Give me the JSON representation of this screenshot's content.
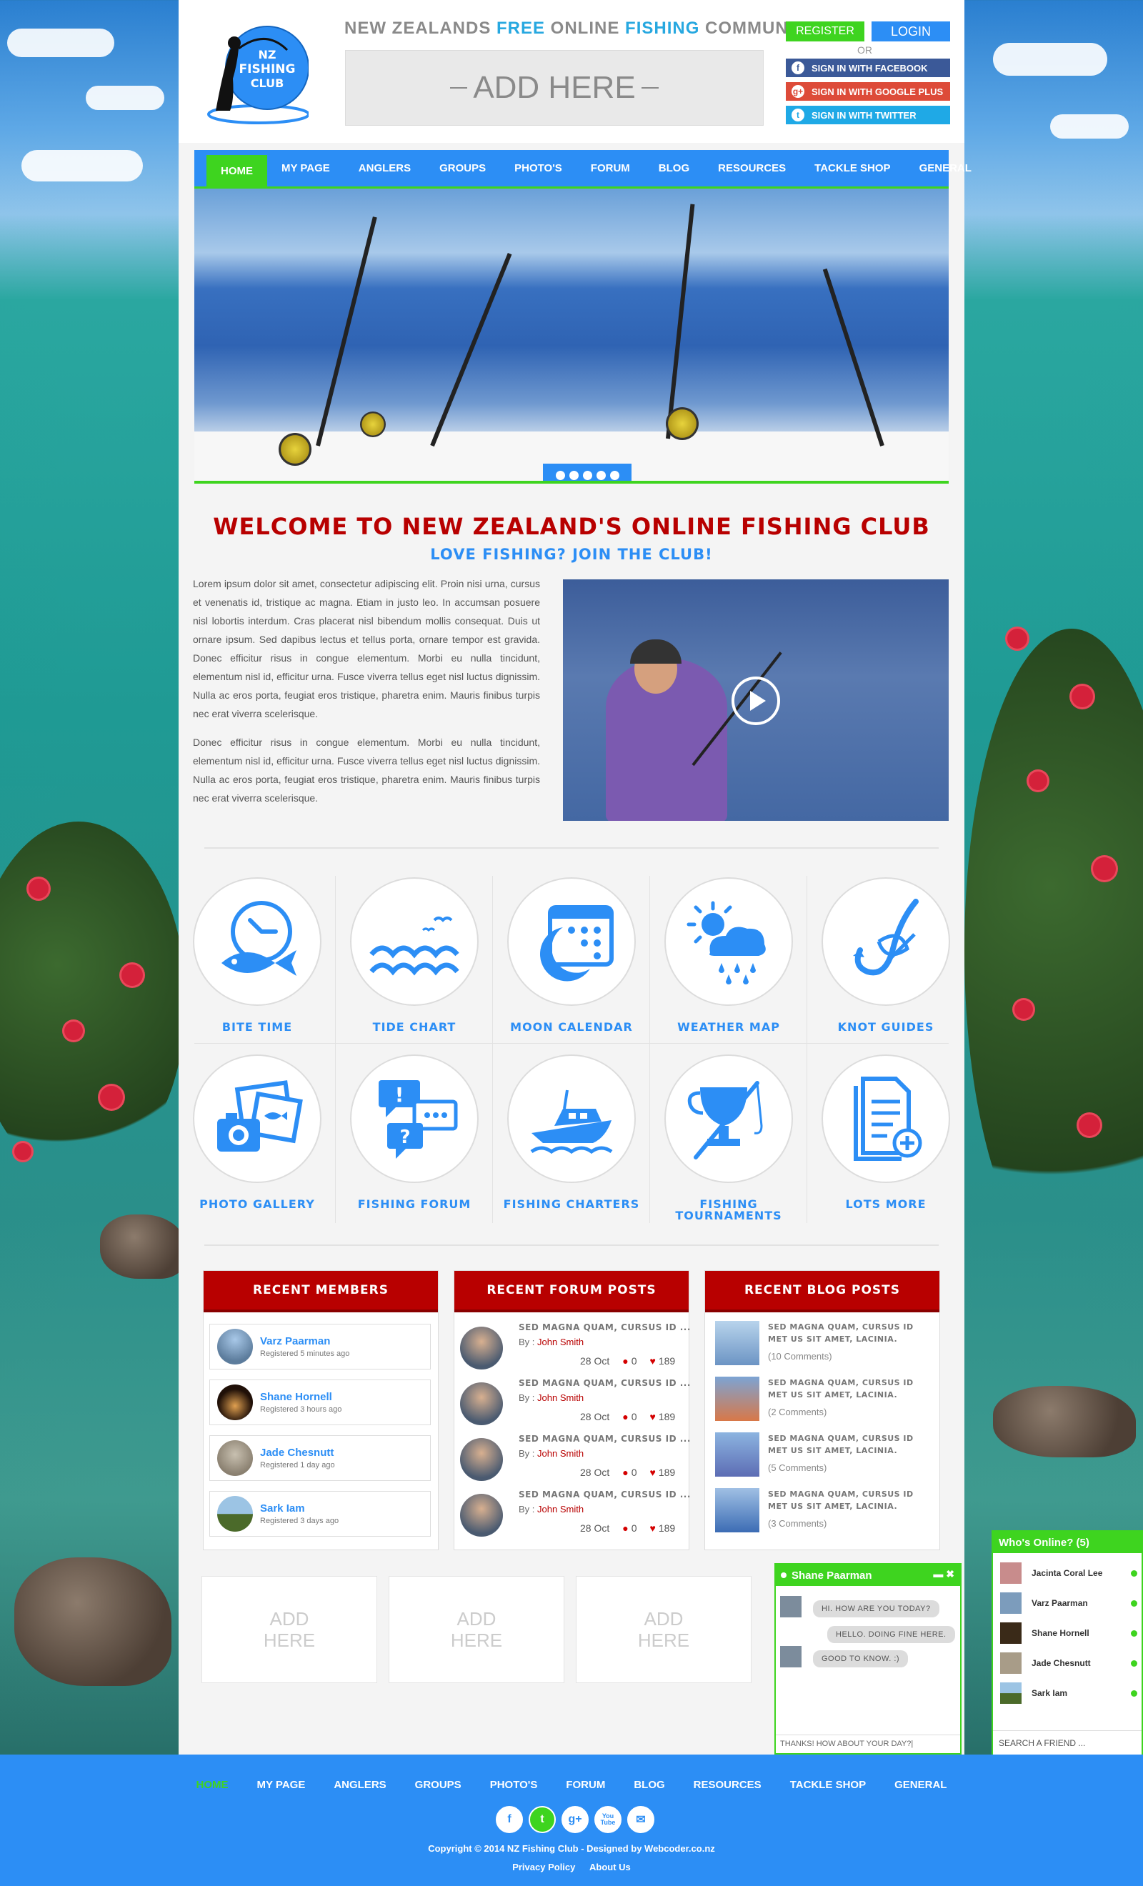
{
  "header": {
    "tagline_parts": [
      "NEW ZEALANDS ",
      "FREE",
      " ONLINE ",
      "FISHING",
      " COMMUNITY"
    ],
    "ad_text": "ADD HERE",
    "logo_text": [
      "NZ",
      "FISHING",
      "CLUB"
    ],
    "register_label": "REGISTER",
    "login_label": "LOGIN",
    "or_label": "OR",
    "facebook_label": "SIGN IN WITH FACEBOOK",
    "google_label": "SIGN IN WITH GOOGLE PLUS",
    "twitter_label": "SIGN IN WITH TWITTER"
  },
  "nav": [
    "HOME",
    "MY PAGE",
    "ANGLERS",
    "GROUPS",
    "PHOTO'S",
    "FORUM",
    "BLOG",
    "RESOURCES",
    "TACKLE SHOP",
    "GENERAL"
  ],
  "slider": {
    "dot_count": 5
  },
  "welcome": {
    "title": "WELCOME TO NEW ZEALAND'S ONLINE FISHING CLUB",
    "subtitle": "LOVE FISHING? JOIN THE CLUB!",
    "p1": " Lorem ipsum dolor sit amet, consectetur adipiscing elit. Proin nisi urna, cursus et venenatis id, tristique ac magna. Etiam in justo leo. In accumsan posuere nisl lobortis interdum. Cras placerat nisl bibendum mollis consequat. Duis ut ornare ipsum. Sed dapibus lectus et tellus porta, ornare tempor est gravida. Donec efficitur risus in congue elementum. Morbi eu nulla tincidunt, elementum nisl id, efficitur urna. Fusce viverra tellus eget nisl luctus dignissim. Nulla ac eros porta, feugiat eros tristique, pharetra enim. Mauris finibus turpis nec erat viverra scelerisque.",
    "p2": "Donec efficitur risus in congue elementum. Morbi eu nulla tincidunt, elementum nisl id, efficitur urna. Fusce viverra tellus eget nisl luctus dignissim. Nulla ac eros porta, feugiat eros tristique, pharetra enim. Mauris finibus turpis nec erat viverra scelerisque."
  },
  "features": [
    {
      "label": "BITE TIME",
      "icon": "clock-fish-icon"
    },
    {
      "label": "TIDE CHART",
      "icon": "waves-icon"
    },
    {
      "label": "MOON CALENDAR",
      "icon": "moon-calendar-icon"
    },
    {
      "label": "WEATHER MAP",
      "icon": "weather-icon"
    },
    {
      "label": "KNOT GUIDES",
      "icon": "hook-knot-icon"
    },
    {
      "label": "PHOTO GALLERY",
      "icon": "photos-icon"
    },
    {
      "label": "FISHING FORUM",
      "icon": "chat-bubbles-icon"
    },
    {
      "label": "FISHING CHARTERS",
      "icon": "boat-icon"
    },
    {
      "label": "FISHING TOURNAMENTS",
      "icon": "trophy-rod-icon"
    },
    {
      "label": "LOTS MORE",
      "icon": "document-add-icon"
    }
  ],
  "recent_members": {
    "title": "RECENT MEMBERS",
    "items": [
      {
        "name": "Varz Paarman",
        "ago": "Registered 5 minutes ago"
      },
      {
        "name": "Shane Hornell",
        "ago": "Registered 3 hours ago"
      },
      {
        "name": "Jade Chesnutt",
        "ago": "Registered 1 day ago"
      },
      {
        "name": "Sark Iam",
        "ago": "Registered 3 days ago"
      }
    ]
  },
  "recent_forum": {
    "title": "RECENT FORUM POSTS",
    "items": [
      {
        "title": "SED MAGNA QUAM, CURSUS ID ...",
        "by_label": "By : ",
        "author": "John Smith",
        "date": "28 Oct",
        "comments": "0",
        "likes": "189"
      },
      {
        "title": "SED MAGNA QUAM, CURSUS ID ...",
        "by_label": "By : ",
        "author": "John Smith",
        "date": "28 Oct",
        "comments": "0",
        "likes": "189"
      },
      {
        "title": "SED MAGNA QUAM, CURSUS ID ...",
        "by_label": "By : ",
        "author": "John Smith",
        "date": "28 Oct",
        "comments": "0",
        "likes": "189"
      },
      {
        "title": "SED MAGNA QUAM, CURSUS ID ...",
        "by_label": "By : ",
        "author": "John Smith",
        "date": "28 Oct",
        "comments": "0",
        "likes": "189"
      }
    ]
  },
  "recent_blog": {
    "title": "RECENT BLOG POSTS",
    "items": [
      {
        "title": "SED MAGNA QUAM, CURSUS ID MET US SIT AMET, LACINIA.",
        "comments": "(10 Comments)"
      },
      {
        "title": "SED MAGNA QUAM, CURSUS ID MET US SIT AMET, LACINIA.",
        "comments": "(2 Comments)"
      },
      {
        "title": "SED MAGNA QUAM, CURSUS ID MET US SIT AMET, LACINIA.",
        "comments": "(5 Comments)"
      },
      {
        "title": "SED MAGNA QUAM, CURSUS ID MET US SIT AMET, LACINIA.",
        "comments": "(3 Comments)"
      }
    ]
  },
  "small_ads": [
    "ADD\nHERE",
    "ADD\nHERE",
    "ADD\nHERE"
  ],
  "chat": {
    "name": "Shane Paarman",
    "controls": "▬ ✖",
    "messages": [
      "HI. HOW ARE YOU TODAY?",
      "HELLO. DOING FINE HERE.",
      "GOOD TO KNOW. :)"
    ],
    "input_text": "THANKS! HOW ABOUT YOUR DAY?|"
  },
  "online": {
    "title": "Who's Online? (5)",
    "users": [
      "Jacinta Coral Lee",
      "Varz Paarman",
      "Shane Hornell",
      "Jade Chesnutt",
      "Sark Iam"
    ],
    "search_placeholder": "SEARCH A FRIEND ..."
  },
  "footer": {
    "nav": [
      "HOME",
      "MY PAGE",
      "ANGLERS",
      "GROUPS",
      "PHOTO'S",
      "FORUM",
      "BLOG",
      "RESOURCES",
      "TACKLE SHOP",
      "GENERAL"
    ],
    "social": [
      "f",
      "t",
      "g+",
      "You Tube",
      "✉"
    ],
    "copyright": "Copyright © 2014 NZ Fishing Club  -  Designed by Webcoder.co.nz",
    "links": [
      "Privacy Policy",
      "About Us"
    ]
  },
  "colors": {
    "brand_blue": "#2c8ef5",
    "brand_green": "#3ed41f",
    "brand_red": "#b80000"
  }
}
